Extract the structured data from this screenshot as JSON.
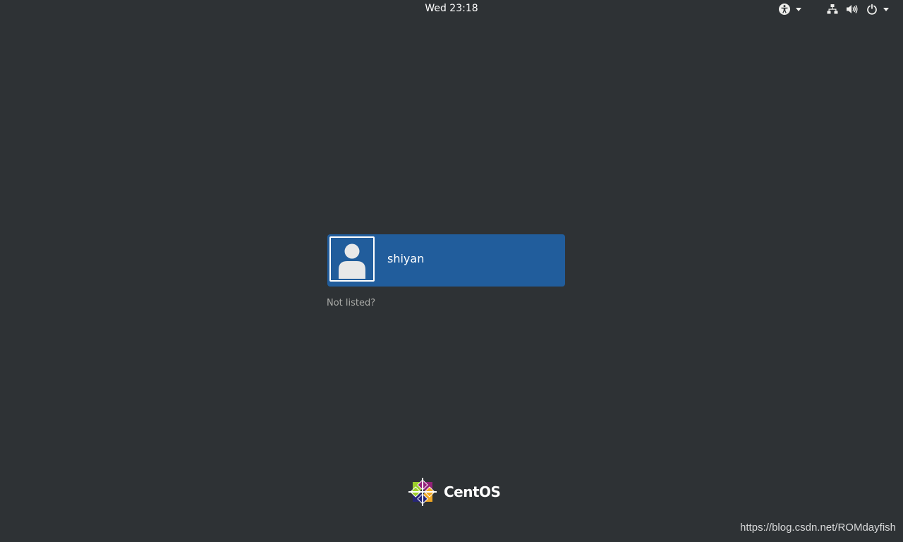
{
  "topbar": {
    "clock": "Wed 23:18",
    "icons": {
      "accessibility": "accessibility-icon",
      "network": "network-icon",
      "volume": "volume-icon",
      "power": "power-icon"
    }
  },
  "login": {
    "user_name": "shiyan",
    "avatar_icon": "user-avatar-icon",
    "not_listed": "Not listed?"
  },
  "branding": {
    "logo_text": "CentOS"
  },
  "watermark": "https://blog.csdn.net/ROMdayfish",
  "colors": {
    "background": "#2e3235",
    "selected_user": "#215d9c",
    "muted_text": "#a9aaa7"
  }
}
